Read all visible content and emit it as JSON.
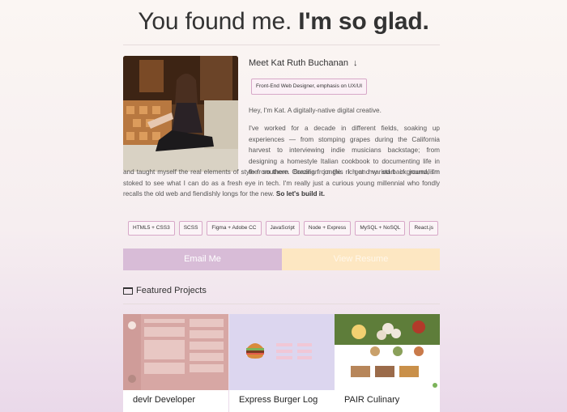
{
  "hero": {
    "light": "You found me.",
    "bold": "I'm so glad."
  },
  "intro": {
    "meet_label": "Meet",
    "name": "Kat Ruth Buchanan",
    "role_badge": "Front-End Web Designer, emphasis on UX/UI",
    "greeting": "Hey, I'm Kat. A digitally-native digital creative.",
    "bio_part1": "I've worked for a decade in different fields, soaking up experiences — from stomping grapes during the California harvest to interviewing indie musicians backstage; from designing a homestyle Italian cookbook to documenting life in the southern Brazilian jungle. I got my start in journalism",
    "bio_part2": "and taught myself the real elements of style from there. Coming from this rich and varied background, I'm stoked to see what I can do as a fresh eye in tech. I'm really just a curious young millennial who fondly recalls the old web and fiendishly longs for the new.",
    "bio_bold": "So let's build it."
  },
  "skills": [
    "HTML5 + CSS3",
    "SCSS",
    "Figma + Adobe CC",
    "JavaScript",
    "Node + Express",
    "MySQL + NoSQL",
    "React.js"
  ],
  "buttons": {
    "email": "Email Me",
    "resume": "View Resume"
  },
  "projects": {
    "heading": "Featured Projects",
    "items": [
      {
        "title": "devlr Developer"
      },
      {
        "title": "Express Burger Log"
      },
      {
        "title": "PAIR Culinary"
      }
    ]
  },
  "colors": {
    "accent_pink": "#d8bcd7",
    "accent_peach": "#fde7c2",
    "badge_border": "#d7a8c8"
  },
  "icons": {
    "name_arrow": "arrow-down-icon",
    "featured": "folder-icon"
  }
}
